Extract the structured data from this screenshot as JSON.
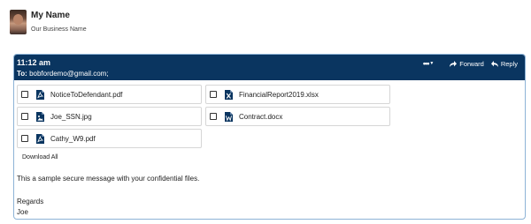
{
  "sender": {
    "name": "My Name",
    "business": "Our Business Name"
  },
  "message": {
    "time": "11:12 am",
    "to_label": "To:",
    "to_value": " bobfordemo@gmail.com;",
    "more_label": "•••",
    "forward_label": "Forward",
    "reply_label": "Reply",
    "download_all": "Download All",
    "body": "This a sample secure message with your confidential files.",
    "closing": "Regards",
    "signature": "Joe"
  },
  "attachments": [
    {
      "name": "NoticeToDefendant.pdf",
      "icon": "pdf-file-icon"
    },
    {
      "name": "FinancialReport2019.xlsx",
      "icon": "excel-file-icon"
    },
    {
      "name": "Joe_SSN.jpg",
      "icon": "image-file-icon"
    },
    {
      "name": "Contract.docx",
      "icon": "word-file-icon"
    },
    {
      "name": "Cathy_W9.pdf",
      "icon": "pdf-file-icon"
    }
  ],
  "colors": {
    "bar": "#0a3560",
    "border": "#8db3d6",
    "icon": "#0a3560"
  }
}
